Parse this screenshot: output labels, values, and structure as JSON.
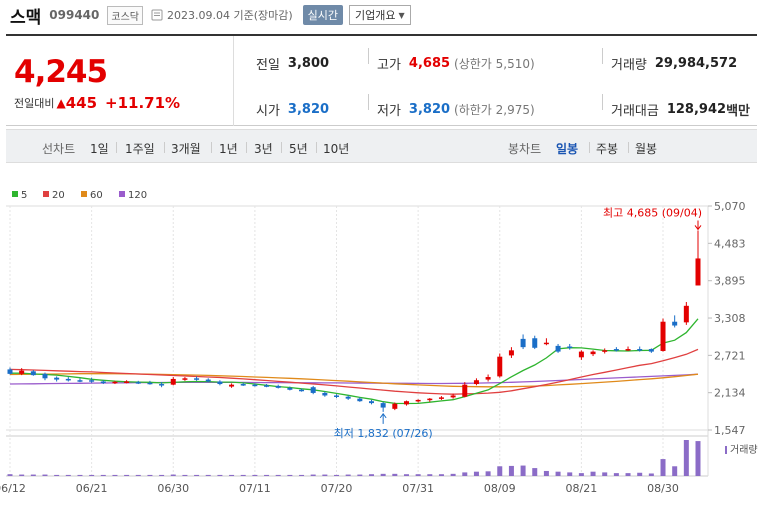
{
  "header": {
    "name": "스맥",
    "code": "099440",
    "market": "코스닥",
    "date": "2023.09.04 기준(장마감)",
    "live_button": "실시간",
    "info_button": "기업개요"
  },
  "summary": {
    "price": "4,245",
    "change_label": "전일대비",
    "change_arrow": "▲",
    "change_value": "445",
    "change_pct": "+11.71%",
    "prev_close_label": "전일",
    "prev_close": "3,800",
    "open_label": "시가",
    "open": "3,820",
    "high_label": "고가",
    "high": "4,685",
    "upper_limit": "(상한가 5,510)",
    "low_label": "저가",
    "low": "3,820",
    "lower_limit": "(하한가 2,975)",
    "volume_label": "거래량",
    "volume": "29,984,572",
    "amount_label": "거래대금",
    "amount": "128,942",
    "amount_unit": "백만"
  },
  "toolbar": {
    "line_label": "선차트",
    "line_periods": [
      "1일",
      "1주일",
      "3개월",
      "1년",
      "3년",
      "5년",
      "10년"
    ],
    "candle_label": "봉차트",
    "candle_periods": [
      "일봉",
      "주봉",
      "월봉"
    ],
    "active_candle": "일봉"
  },
  "colors": {
    "up": "#e30000",
    "down": "#1a6ec7",
    "ma5": "#2fb52f",
    "ma20": "#e04040",
    "ma60": "#e08a1a",
    "ma120": "#9a5ccc",
    "volume": "#8b6cc7"
  },
  "chart_data": {
    "type": "candlestick",
    "legend": [
      {
        "name": "5",
        "color": "#2fb52f"
      },
      {
        "name": "20",
        "color": "#e04040"
      },
      {
        "name": "60",
        "color": "#e08a1a"
      },
      {
        "name": "120",
        "color": "#9a5ccc"
      }
    ],
    "y_ticks": [
      "5,070",
      "4,483",
      "3,895",
      "3,308",
      "2,721",
      "2,134",
      "1,547"
    ],
    "ylim": [
      1547,
      5070
    ],
    "x_ticks": [
      "06/12",
      "06/21",
      "06/30",
      "07/11",
      "07/20",
      "07/31",
      "08/09",
      "08/21",
      "08/30"
    ],
    "volume_label": "거래량",
    "annotations": {
      "high": "최고 4,685 (09/04)",
      "low": "최저 1,832 (07/26)"
    },
    "candles": [
      {
        "d": "06/12",
        "o": 2500,
        "h": 2530,
        "l": 2420,
        "c": 2430
      },
      {
        "d": "06/13",
        "o": 2430,
        "h": 2520,
        "l": 2410,
        "c": 2480
      },
      {
        "d": "06/14",
        "o": 2470,
        "h": 2490,
        "l": 2400,
        "c": 2410
      },
      {
        "d": "06/15",
        "o": 2430,
        "h": 2450,
        "l": 2330,
        "c": 2360
      },
      {
        "d": "06/16",
        "o": 2370,
        "h": 2390,
        "l": 2310,
        "c": 2340
      },
      {
        "d": "06/19",
        "o": 2350,
        "h": 2380,
        "l": 2310,
        "c": 2330
      },
      {
        "d": "06/20",
        "o": 2330,
        "h": 2360,
        "l": 2300,
        "c": 2320
      },
      {
        "d": "06/21",
        "o": 2330,
        "h": 2370,
        "l": 2290,
        "c": 2310
      },
      {
        "d": "06/22",
        "o": 2310,
        "h": 2330,
        "l": 2270,
        "c": 2290
      },
      {
        "d": "06/23",
        "o": 2290,
        "h": 2320,
        "l": 2270,
        "c": 2305
      },
      {
        "d": "06/26",
        "o": 2300,
        "h": 2330,
        "l": 2280,
        "c": 2310
      },
      {
        "d": "06/27",
        "o": 2300,
        "h": 2320,
        "l": 2270,
        "c": 2280
      },
      {
        "d": "06/28",
        "o": 2290,
        "h": 2320,
        "l": 2260,
        "c": 2275
      },
      {
        "d": "06/29",
        "o": 2270,
        "h": 2300,
        "l": 2220,
        "c": 2250
      },
      {
        "d": "06/30",
        "o": 2260,
        "h": 2380,
        "l": 2250,
        "c": 2350
      },
      {
        "d": "07/03",
        "o": 2350,
        "h": 2380,
        "l": 2320,
        "c": 2360
      },
      {
        "d": "07/04",
        "o": 2360,
        "h": 2390,
        "l": 2320,
        "c": 2340
      },
      {
        "d": "07/05",
        "o": 2340,
        "h": 2360,
        "l": 2300,
        "c": 2310
      },
      {
        "d": "07/06",
        "o": 2310,
        "h": 2330,
        "l": 2250,
        "c": 2270
      },
      {
        "d": "07/07",
        "o": 2230,
        "h": 2280,
        "l": 2210,
        "c": 2260
      },
      {
        "d": "07/10",
        "o": 2270,
        "h": 2290,
        "l": 2240,
        "c": 2255
      },
      {
        "d": "07/11",
        "o": 2260,
        "h": 2280,
        "l": 2230,
        "c": 2245
      },
      {
        "d": "07/12",
        "o": 2250,
        "h": 2270,
        "l": 2220,
        "c": 2230
      },
      {
        "d": "07/13",
        "o": 2240,
        "h": 2260,
        "l": 2200,
        "c": 2210
      },
      {
        "d": "07/14",
        "o": 2210,
        "h": 2230,
        "l": 2170,
        "c": 2180
      },
      {
        "d": "07/17",
        "o": 2180,
        "h": 2200,
        "l": 2150,
        "c": 2170
      },
      {
        "d": "07/18",
        "o": 2220,
        "h": 2240,
        "l": 2110,
        "c": 2130
      },
      {
        "d": "07/19",
        "o": 2130,
        "h": 2150,
        "l": 2070,
        "c": 2090
      },
      {
        "d": "07/20",
        "o": 2090,
        "h": 2110,
        "l": 2050,
        "c": 2070
      },
      {
        "d": "07/21",
        "o": 2070,
        "h": 2090,
        "l": 2020,
        "c": 2040
      },
      {
        "d": "07/24",
        "o": 2040,
        "h": 2060,
        "l": 1990,
        "c": 2000
      },
      {
        "d": "07/25",
        "o": 2000,
        "h": 2020,
        "l": 1950,
        "c": 1970
      },
      {
        "d": "07/26",
        "o": 1970,
        "h": 1990,
        "l": 1832,
        "c": 1900
      },
      {
        "d": "07/27",
        "o": 1880,
        "h": 1980,
        "l": 1860,
        "c": 1960
      },
      {
        "d": "07/28",
        "o": 1950,
        "h": 2010,
        "l": 1930,
        "c": 2000
      },
      {
        "d": "07/31",
        "o": 2000,
        "h": 2030,
        "l": 1980,
        "c": 2020
      },
      {
        "d": "08/01",
        "o": 2020,
        "h": 2050,
        "l": 1990,
        "c": 2040
      },
      {
        "d": "08/02",
        "o": 2040,
        "h": 2080,
        "l": 2020,
        "c": 2060
      },
      {
        "d": "08/03",
        "o": 2060,
        "h": 2120,
        "l": 2040,
        "c": 2090
      },
      {
        "d": "08/04",
        "o": 2070,
        "h": 2300,
        "l": 2060,
        "c": 2260
      },
      {
        "d": "08/07",
        "o": 2270,
        "h": 2360,
        "l": 2250,
        "c": 2330
      },
      {
        "d": "08/08",
        "o": 2340,
        "h": 2420,
        "l": 2310,
        "c": 2380
      },
      {
        "d": "08/09",
        "o": 2390,
        "h": 2750,
        "l": 2370,
        "c": 2700
      },
      {
        "d": "08/10",
        "o": 2720,
        "h": 2850,
        "l": 2680,
        "c": 2800
      },
      {
        "d": "08/11",
        "o": 2980,
        "h": 3050,
        "l": 2820,
        "c": 2850
      },
      {
        "d": "08/14",
        "o": 2990,
        "h": 3030,
        "l": 2820,
        "c": 2840
      },
      {
        "d": "08/16",
        "o": 2920,
        "h": 2990,
        "l": 2880,
        "c": 2920
      },
      {
        "d": "08/17",
        "o": 2870,
        "h": 2900,
        "l": 2760,
        "c": 2780
      },
      {
        "d": "08/18",
        "o": 2860,
        "h": 2900,
        "l": 2810,
        "c": 2840
      },
      {
        "d": "08/21",
        "o": 2690,
        "h": 2800,
        "l": 2650,
        "c": 2780
      },
      {
        "d": "08/22",
        "o": 2740,
        "h": 2800,
        "l": 2710,
        "c": 2780
      },
      {
        "d": "08/23",
        "o": 2780,
        "h": 2830,
        "l": 2750,
        "c": 2800
      },
      {
        "d": "08/24",
        "o": 2820,
        "h": 2850,
        "l": 2780,
        "c": 2800
      },
      {
        "d": "08/25",
        "o": 2820,
        "h": 2860,
        "l": 2790,
        "c": 2820
      },
      {
        "d": "08/28",
        "o": 2820,
        "h": 2860,
        "l": 2780,
        "c": 2800
      },
      {
        "d": "08/29",
        "o": 2820,
        "h": 2830,
        "l": 2760,
        "c": 2780
      },
      {
        "d": "08/30",
        "o": 2790,
        "h": 3300,
        "l": 2780,
        "c": 3250
      },
      {
        "d": "08/31",
        "o": 3250,
        "h": 3350,
        "l": 3160,
        "c": 3190
      },
      {
        "d": "09/01",
        "o": 3240,
        "h": 3560,
        "l": 3200,
        "c": 3500
      },
      {
        "d": "09/04",
        "o": 3820,
        "h": 4685,
        "l": 3820,
        "c": 4245
      }
    ],
    "ma5": [
      2440,
      2440,
      2430,
      2420,
      2410,
      2390,
      2370,
      2345,
      2328,
      2315,
      2305,
      2300,
      2297,
      2288,
      2295,
      2305,
      2310,
      2308,
      2300,
      2300,
      2288,
      2270,
      2250,
      2230,
      2215,
      2195,
      2180,
      2152,
      2122,
      2092,
      2060,
      2032,
      1992,
      1966,
      1964,
      1966,
      1984,
      2004,
      2024,
      2072,
      2125,
      2178,
      2277,
      2384,
      2483,
      2569,
      2681,
      2822,
      2841,
      2838,
      2819,
      2797,
      2792,
      2789,
      2797,
      2800,
      2913,
      2960,
      3079,
      3296
    ],
    "ma20": [
      2500,
      2495,
      2490,
      2484,
      2478,
      2472,
      2466,
      2460,
      2452,
      2444,
      2436,
      2428,
      2420,
      2412,
      2404,
      2396,
      2388,
      2380,
      2372,
      2362,
      2350,
      2338,
      2326,
      2312,
      2298,
      2284,
      2270,
      2256,
      2240,
      2224,
      2208,
      2190,
      2174,
      2158,
      2144,
      2132,
      2122,
      2114,
      2110,
      2114,
      2120,
      2128,
      2140,
      2164,
      2196,
      2228,
      2262,
      2300,
      2340,
      2380,
      2420,
      2455,
      2490,
      2528,
      2565,
      2592,
      2636,
      2685,
      2738,
      2815
    ],
    "ma60": [
      2420,
      2422,
      2424,
      2426,
      2428,
      2430,
      2432,
      2433,
      2433,
      2432,
      2430,
      2428,
      2425,
      2422,
      2418,
      2414,
      2410,
      2405,
      2400,
      2394,
      2388,
      2381,
      2374,
      2367,
      2360,
      2352,
      2343,
      2334,
      2324,
      2314,
      2304,
      2294,
      2284,
      2274,
      2265,
      2256,
      2248,
      2241,
      2235,
      2231,
      2228,
      2226,
      2226,
      2228,
      2232,
      2238,
      2246,
      2256,
      2266,
      2276,
      2288,
      2300,
      2312,
      2326,
      2340,
      2352,
      2368,
      2386,
      2404,
      2425
    ],
    "ma120": [
      2270,
      2272,
      2274,
      2276,
      2278,
      2280,
      2282,
      2284,
      2286,
      2288,
      2290,
      2292,
      2293,
      2294,
      2295,
      2296,
      2296,
      2296,
      2296,
      2296,
      2295,
      2294,
      2293,
      2292,
      2291,
      2290,
      2289,
      2288,
      2287,
      2286,
      2285,
      2284,
      2283,
      2282,
      2281,
      2280,
      2279,
      2279,
      2280,
      2282,
      2285,
      2288,
      2292,
      2297,
      2303,
      2310,
      2318,
      2326,
      2334,
      2342,
      2350,
      2358,
      2366,
      2374,
      2382,
      2390,
      2398,
      2406,
      2414,
      2425
    ],
    "volumes": [
      0.05,
      0.04,
      0.04,
      0.04,
      0.03,
      0.03,
      0.03,
      0.03,
      0.03,
      0.03,
      0.03,
      0.03,
      0.03,
      0.03,
      0.04,
      0.03,
      0.03,
      0.03,
      0.03,
      0.03,
      0.03,
      0.03,
      0.03,
      0.03,
      0.03,
      0.03,
      0.04,
      0.04,
      0.03,
      0.04,
      0.04,
      0.05,
      0.06,
      0.06,
      0.05,
      0.05,
      0.05,
      0.05,
      0.06,
      0.1,
      0.12,
      0.13,
      0.27,
      0.28,
      0.29,
      0.22,
      0.14,
      0.12,
      0.1,
      0.08,
      0.12,
      0.1,
      0.08,
      0.08,
      0.09,
      0.07,
      0.47,
      0.27,
      1.0,
      0.97
    ]
  }
}
